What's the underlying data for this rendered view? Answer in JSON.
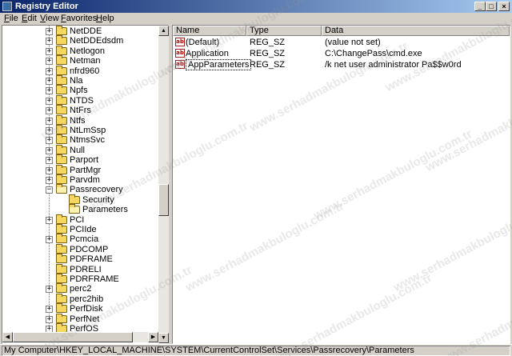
{
  "window": {
    "title": "Registry Editor",
    "minimize_glyph": "_",
    "maximize_glyph": "□",
    "close_glyph": "×"
  },
  "menu": {
    "items": [
      {
        "label": "File",
        "accel": "F",
        "rest": "ile"
      },
      {
        "label": "Edit",
        "accel": "E",
        "rest": "dit"
      },
      {
        "label": "View",
        "accel": "V",
        "rest": "iew"
      },
      {
        "label": "Favorites",
        "accel": "F",
        "rest": "avorites"
      },
      {
        "label": "Help",
        "accel": "H",
        "rest": "elp"
      }
    ]
  },
  "tree": {
    "nodes": [
      {
        "label": "NetDDE",
        "depth": 0,
        "expander": "+",
        "open": false
      },
      {
        "label": "NetDDEdsdm",
        "depth": 0,
        "expander": "+",
        "open": false
      },
      {
        "label": "Netlogon",
        "depth": 0,
        "expander": "+",
        "open": false
      },
      {
        "label": "Netman",
        "depth": 0,
        "expander": "+",
        "open": false
      },
      {
        "label": "nfrd960",
        "depth": 0,
        "expander": "+",
        "open": false
      },
      {
        "label": "Nla",
        "depth": 0,
        "expander": "+",
        "open": false
      },
      {
        "label": "Npfs",
        "depth": 0,
        "expander": "+",
        "open": false
      },
      {
        "label": "NTDS",
        "depth": 0,
        "expander": "+",
        "open": false
      },
      {
        "label": "NtFrs",
        "depth": 0,
        "expander": "+",
        "open": false
      },
      {
        "label": "Ntfs",
        "depth": 0,
        "expander": "+",
        "open": false
      },
      {
        "label": "NtLmSsp",
        "depth": 0,
        "expander": "+",
        "open": false
      },
      {
        "label": "NtmsSvc",
        "depth": 0,
        "expander": "+",
        "open": false
      },
      {
        "label": "Null",
        "depth": 0,
        "expander": "+",
        "open": false
      },
      {
        "label": "Parport",
        "depth": 0,
        "expander": "+",
        "open": false
      },
      {
        "label": "PartMgr",
        "depth": 0,
        "expander": "+",
        "open": false
      },
      {
        "label": "Parvdm",
        "depth": 0,
        "expander": "+",
        "open": false
      },
      {
        "label": "Passrecovery",
        "depth": 0,
        "expander": "−",
        "open": true
      },
      {
        "label": "Security",
        "depth": 1,
        "expander": "",
        "open": false
      },
      {
        "label": "Parameters",
        "depth": 1,
        "expander": "",
        "open": true
      },
      {
        "label": "PCI",
        "depth": 0,
        "expander": "+",
        "open": false
      },
      {
        "label": "PCIIde",
        "depth": 0,
        "expander": "",
        "open": false
      },
      {
        "label": "Pcmcia",
        "depth": 0,
        "expander": "+",
        "open": false
      },
      {
        "label": "PDCOMP",
        "depth": 0,
        "expander": "",
        "open": false
      },
      {
        "label": "PDFRAME",
        "depth": 0,
        "expander": "",
        "open": false
      },
      {
        "label": "PDRELI",
        "depth": 0,
        "expander": "",
        "open": false
      },
      {
        "label": "PDRFRAME",
        "depth": 0,
        "expander": "",
        "open": false
      },
      {
        "label": "perc2",
        "depth": 0,
        "expander": "+",
        "open": false
      },
      {
        "label": "perc2hib",
        "depth": 0,
        "expander": "",
        "open": false
      },
      {
        "label": "PerfDisk",
        "depth": 0,
        "expander": "+",
        "open": false
      },
      {
        "label": "PerfNet",
        "depth": 0,
        "expander": "+",
        "open": false
      },
      {
        "label": "PerfOS",
        "depth": 0,
        "expander": "+",
        "open": false
      }
    ]
  },
  "list": {
    "columns": [
      "Name",
      "Type",
      "Data"
    ],
    "icon_text": "ab",
    "rows": [
      {
        "name": "(Default)",
        "type": "REG_SZ",
        "data": "(value not set)",
        "selected": false
      },
      {
        "name": "Application",
        "type": "REG_SZ",
        "data": "C:\\ChangePass\\cmd.exe",
        "selected": false
      },
      {
        "name": "AppParameters",
        "type": "REG_SZ",
        "data": "/k net user administrator Pa$$w0rd",
        "selected": true
      }
    ]
  },
  "statusbar": {
    "path": "My Computer\\HKEY_LOCAL_MACHINE\\SYSTEM\\CurrentControlSet\\Services\\Passrecovery\\Parameters"
  },
  "watermark": "www.serhadmakbuloglu.com.tr",
  "colors": {
    "titlebar_start": "#0a246a",
    "titlebar_end": "#a6caf0",
    "face": "#d4d0c8",
    "folder": "#f4d860"
  }
}
